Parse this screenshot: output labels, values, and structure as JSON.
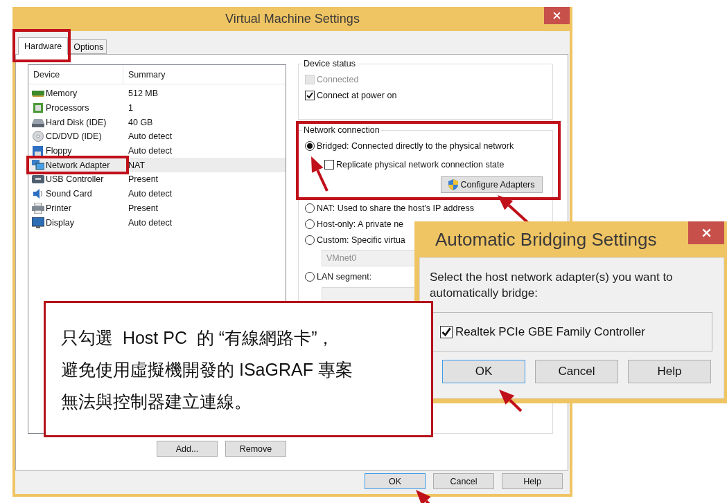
{
  "window": {
    "title": "Virtual Machine Settings"
  },
  "tabs": [
    {
      "label": "Hardware",
      "selected": true
    },
    {
      "label": "Options",
      "selected": false
    }
  ],
  "devices": {
    "columns": [
      "Device",
      "Summary"
    ],
    "rows": [
      {
        "kind": "memory",
        "device": "Memory",
        "summary": "512 MB",
        "selected": false
      },
      {
        "kind": "processor",
        "device": "Processors",
        "summary": "1",
        "selected": false
      },
      {
        "kind": "disk",
        "device": "Hard Disk (IDE)",
        "summary": "40 GB",
        "selected": false
      },
      {
        "kind": "cd",
        "device": "CD/DVD (IDE)",
        "summary": "Auto detect",
        "selected": false
      },
      {
        "kind": "floppy",
        "device": "Floppy",
        "summary": "Auto detect",
        "selected": false
      },
      {
        "kind": "network",
        "device": "Network Adapter",
        "summary": "NAT",
        "selected": true
      },
      {
        "kind": "usb",
        "device": "USB Controller",
        "summary": "Present",
        "selected": false
      },
      {
        "kind": "sound",
        "device": "Sound Card",
        "summary": "Auto detect",
        "selected": false
      },
      {
        "kind": "printer",
        "device": "Printer",
        "summary": "Present",
        "selected": false
      },
      {
        "kind": "display",
        "device": "Display",
        "summary": "Auto detect",
        "selected": false
      }
    ]
  },
  "device_buttons": [
    "Add...",
    "Remove"
  ],
  "device_status": {
    "title": "Device status",
    "checkboxes": [
      {
        "label": "Connected",
        "checked": false,
        "disabled": true
      },
      {
        "label": "Connect at power on",
        "checked": true,
        "disabled": false
      }
    ]
  },
  "network_connection": {
    "title": "Network connection",
    "bridged": {
      "label": "Bridged: Connected directly to the physical network",
      "selected": true
    },
    "replicate": {
      "label": "Replicate physical network connection state",
      "checked": false
    },
    "configure_button": "Configure Adapters",
    "options": [
      {
        "label": "NAT: Used to share the host's IP address",
        "selected": false
      },
      {
        "label": "Host-only: A private ne",
        "selected": false
      },
      {
        "label": "Custom: Specific virtua",
        "selected": false
      }
    ],
    "custom_value": "VMnet0",
    "lan": {
      "label": "LAN segment:",
      "selected": false
    }
  },
  "footer_buttons": [
    "OK",
    "Cancel",
    "Help"
  ],
  "bridging_dialog": {
    "title": "Automatic Bridging Settings",
    "prompt": "Select the host network adapter(s) you want to automatically bridge:",
    "adapters": [
      {
        "label": "Realtek PCIe GBE Family Controller",
        "checked": true
      }
    ],
    "buttons": [
      "OK",
      "Cancel",
      "Help"
    ]
  },
  "callout": {
    "lines": [
      "只勾選  Host PC  的 “有線網路卡”，",
      "避免使用虛擬機開發的 ISaGRAF 專案",
      "無法與控制器建立連線。"
    ]
  }
}
